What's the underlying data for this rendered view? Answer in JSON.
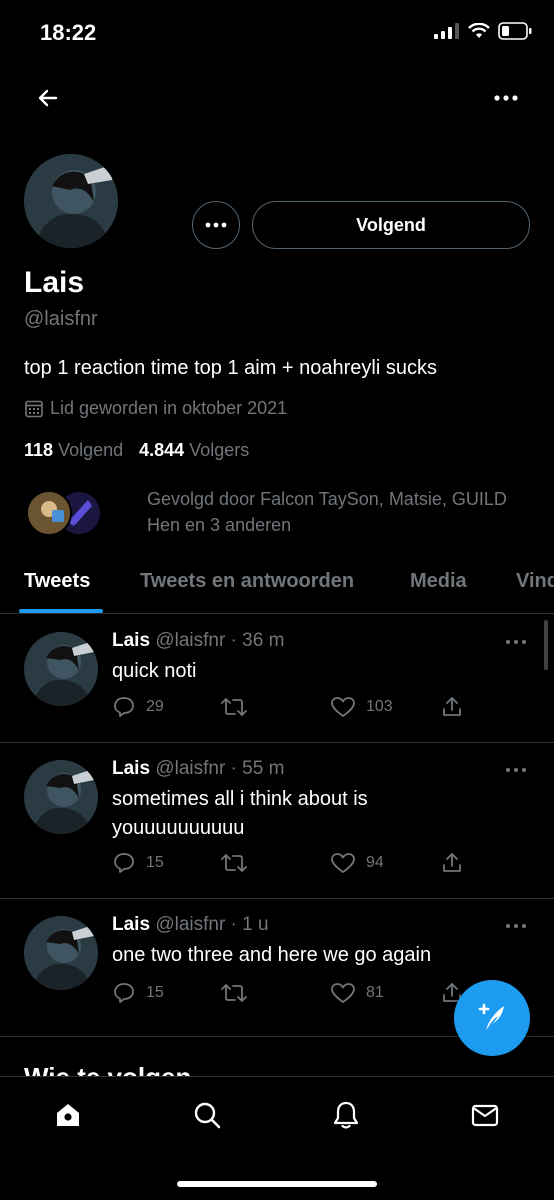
{
  "status_bar": {
    "time": "18:22"
  },
  "profile": {
    "display_name": "Lais",
    "handle": "@laisfnr",
    "bio": "top 1 reaction time top 1 aim + noahreyli sucks",
    "joined": "Lid geworden in oktober 2021",
    "following_count": "118",
    "following_label": "Volgend",
    "followers_count": "4.844",
    "followers_label": "Volgers",
    "follow_button_label": "Volgend",
    "followed_by_line1": "Gevolgd door Falcon TaySon, Matsie, GUILD",
    "followed_by_line2": "Hen en 3 anderen"
  },
  "tabs": [
    {
      "label": "Tweets"
    },
    {
      "label": "Tweets en antwoorden"
    },
    {
      "label": "Media"
    },
    {
      "label": "Vind ik leuk"
    }
  ],
  "tweets": [
    {
      "name": "Lais",
      "meta": "@laisfnr · 36 m",
      "text": "quick noti",
      "replies": "29",
      "likes": "103"
    },
    {
      "name": "Lais",
      "meta": "@laisfnr · 55 m",
      "text": "sometimes all i think about is youuuuuuuuuu",
      "replies": "15",
      "likes": "94"
    },
    {
      "name": "Lais",
      "meta": "@laisfnr · 1 u",
      "text": "one two three and here we go again",
      "replies": "15",
      "likes": "81"
    }
  ],
  "who_to_follow": "Wie te volgen",
  "colors": {
    "accent": "#1d9bf0",
    "muted": "#71767b",
    "background": "#000000"
  },
  "icons": [
    "back-arrow-icon",
    "more-icon",
    "calendar-icon",
    "reply-icon",
    "retweet-icon",
    "like-icon",
    "share-icon",
    "compose-icon",
    "home-icon",
    "search-icon",
    "bell-icon",
    "mail-icon"
  ]
}
